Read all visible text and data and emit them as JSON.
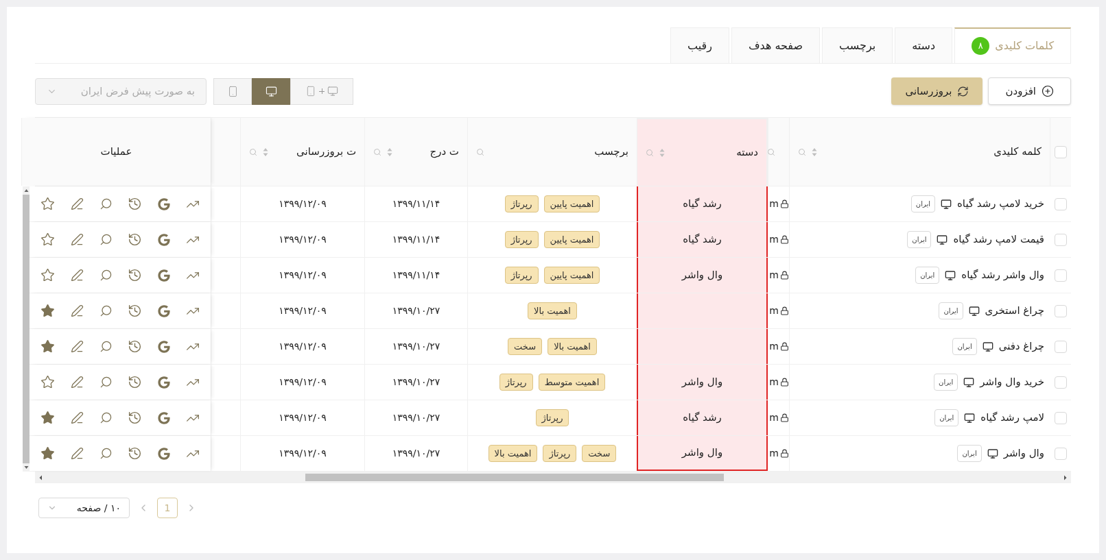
{
  "tabs": [
    {
      "label": "کلمات کلیدی",
      "badge": "۸",
      "selected": true
    },
    {
      "label": "دسته",
      "selected": false
    },
    {
      "label": "برچسب",
      "selected": false
    },
    {
      "label": "صفحه هدف",
      "selected": false
    },
    {
      "label": "رقیب",
      "selected": false
    }
  ],
  "toolbar": {
    "add_button": "افزودن",
    "refresh_button": "بروزرسانی",
    "device_options": [
      {
        "kind": "both",
        "selected": false
      },
      {
        "kind": "desktop",
        "selected": true
      },
      {
        "kind": "mobile",
        "selected": false
      }
    ],
    "region_select": {
      "value": "به صورت پیش فرض ایران",
      "disabled": true
    }
  },
  "table": {
    "columns": [
      {
        "kind": "checkbox",
        "checked": false
      },
      {
        "kind": "text",
        "label": "کلمه کلیدی",
        "sortable": true,
        "searchable": true,
        "highlighted": false
      },
      {
        "kind": "text",
        "sortable": false,
        "searchable": true,
        "highlighted": false
      },
      {
        "kind": "text",
        "label": "دسته",
        "sortable": true,
        "searchable": true,
        "highlighted": true
      },
      {
        "kind": "text",
        "label": "برچسب",
        "sortable": false,
        "searchable": true,
        "highlighted": false
      },
      {
        "kind": "text",
        "label": "ت درج",
        "sortable": true,
        "searchable": true,
        "highlighted": false
      },
      {
        "kind": "text",
        "label": "ت بروزرسانی",
        "sortable": true,
        "searchable": true,
        "highlighted": false
      },
      {
        "kind": "empty"
      },
      {
        "kind": "text",
        "label": "عملیات",
        "sortable": false,
        "searchable": false,
        "highlighted": false
      }
    ],
    "rows": [
      {
        "checked": false,
        "keyword": "خرید لامپ رشد گیاه",
        "region": "ایران",
        "column_3": "m",
        "category": "رشد گیاه",
        "tags": [
          "اهمیت پایین",
          "رپرتاژ"
        ],
        "inserted": "۱۳۹۹/۱۱/۱۴",
        "updated": "۱۳۹۹/۱۲/۰۹",
        "starred": false
      },
      {
        "checked": false,
        "keyword": "قیمت لامپ رشد گیاه",
        "region": "ایران",
        "column_3": "m",
        "category": "رشد گیاه",
        "tags": [
          "اهمیت پایین",
          "رپرتاژ"
        ],
        "inserted": "۱۳۹۹/۱۱/۱۴",
        "updated": "۱۳۹۹/۱۲/۰۹",
        "starred": false
      },
      {
        "checked": false,
        "keyword": "وال واشر رشد گیاه",
        "region": "ایران",
        "column_3": "m",
        "category": "وال واشر",
        "tags": [
          "اهمیت پایین",
          "رپرتاژ"
        ],
        "inserted": "۱۳۹۹/۱۱/۱۴",
        "updated": "۱۳۹۹/۱۲/۰۹",
        "starred": false
      },
      {
        "checked": false,
        "keyword": "چراغ استخری",
        "region": "ایران",
        "column_3": "m",
        "tags": [
          "اهمیت بالا"
        ],
        "inserted": "۱۳۹۹/۱۰/۲۷",
        "updated": "۱۳۹۹/۱۲/۰۹",
        "starred": true
      },
      {
        "checked": false,
        "keyword": "چراغ دفنی",
        "region": "ایران",
        "column_3": "m",
        "tags": [
          "اهمیت بالا",
          "سخت"
        ],
        "inserted": "۱۳۹۹/۱۰/۲۷",
        "updated": "۱۳۹۹/۱۲/۰۹",
        "starred": true
      },
      {
        "checked": false,
        "keyword": "خرید وال واشر",
        "region": "ایران",
        "column_3": "m",
        "category": "وال واشر",
        "tags": [
          "اهمیت متوسط",
          "رپرتاژ"
        ],
        "inserted": "۱۳۹۹/۱۰/۲۷",
        "updated": "۱۳۹۹/۱۲/۰۹",
        "starred": false
      },
      {
        "checked": false,
        "keyword": "لامپ رشد گیاه",
        "region": "ایران",
        "column_3": "m",
        "category": "رشد گیاه",
        "tags": [
          "رپرتاژ"
        ],
        "inserted": "۱۳۹۹/۱۰/۲۷",
        "updated": "۱۳۹۹/۱۲/۰۹",
        "starred": true
      },
      {
        "checked": false,
        "keyword": "وال واشر",
        "region": "ایران",
        "column_3": "m",
        "category": "وال واشر",
        "tags": [
          "سخت",
          "رپرتاژ",
          "اهمیت بالا"
        ],
        "inserted": "۱۳۹۹/۱۰/۲۷",
        "updated": "۱۳۹۹/۱۲/۰۹",
        "starred": true
      }
    ]
  },
  "pagination": {
    "page_size": "۱۰ / صفحه",
    "pages": [
      {
        "label": "1",
        "selected": true
      }
    ]
  }
}
